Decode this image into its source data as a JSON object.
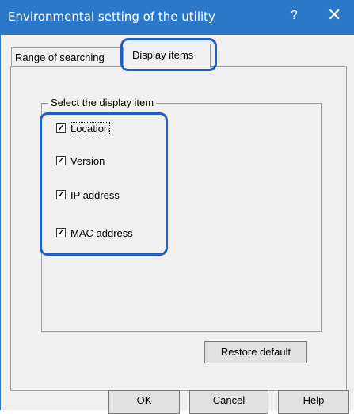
{
  "window": {
    "title": "Environmental setting of the utility",
    "help_glyph": "?",
    "close_glyph": "✕"
  },
  "tabs": [
    {
      "label": "Range of searching"
    },
    {
      "label": "Display items"
    }
  ],
  "group": {
    "label": "Select the display item"
  },
  "checkboxes": [
    {
      "label": "Location",
      "checked": true
    },
    {
      "label": "Version",
      "checked": true
    },
    {
      "label": "IP address",
      "checked": true
    },
    {
      "label": "MAC address",
      "checked": true
    }
  ],
  "buttons": {
    "restore": "Restore default",
    "ok": "OK",
    "cancel": "Cancel",
    "help": "Help"
  },
  "colors": {
    "titlebar": "#2b78c9",
    "highlight": "#1f5fc4"
  }
}
